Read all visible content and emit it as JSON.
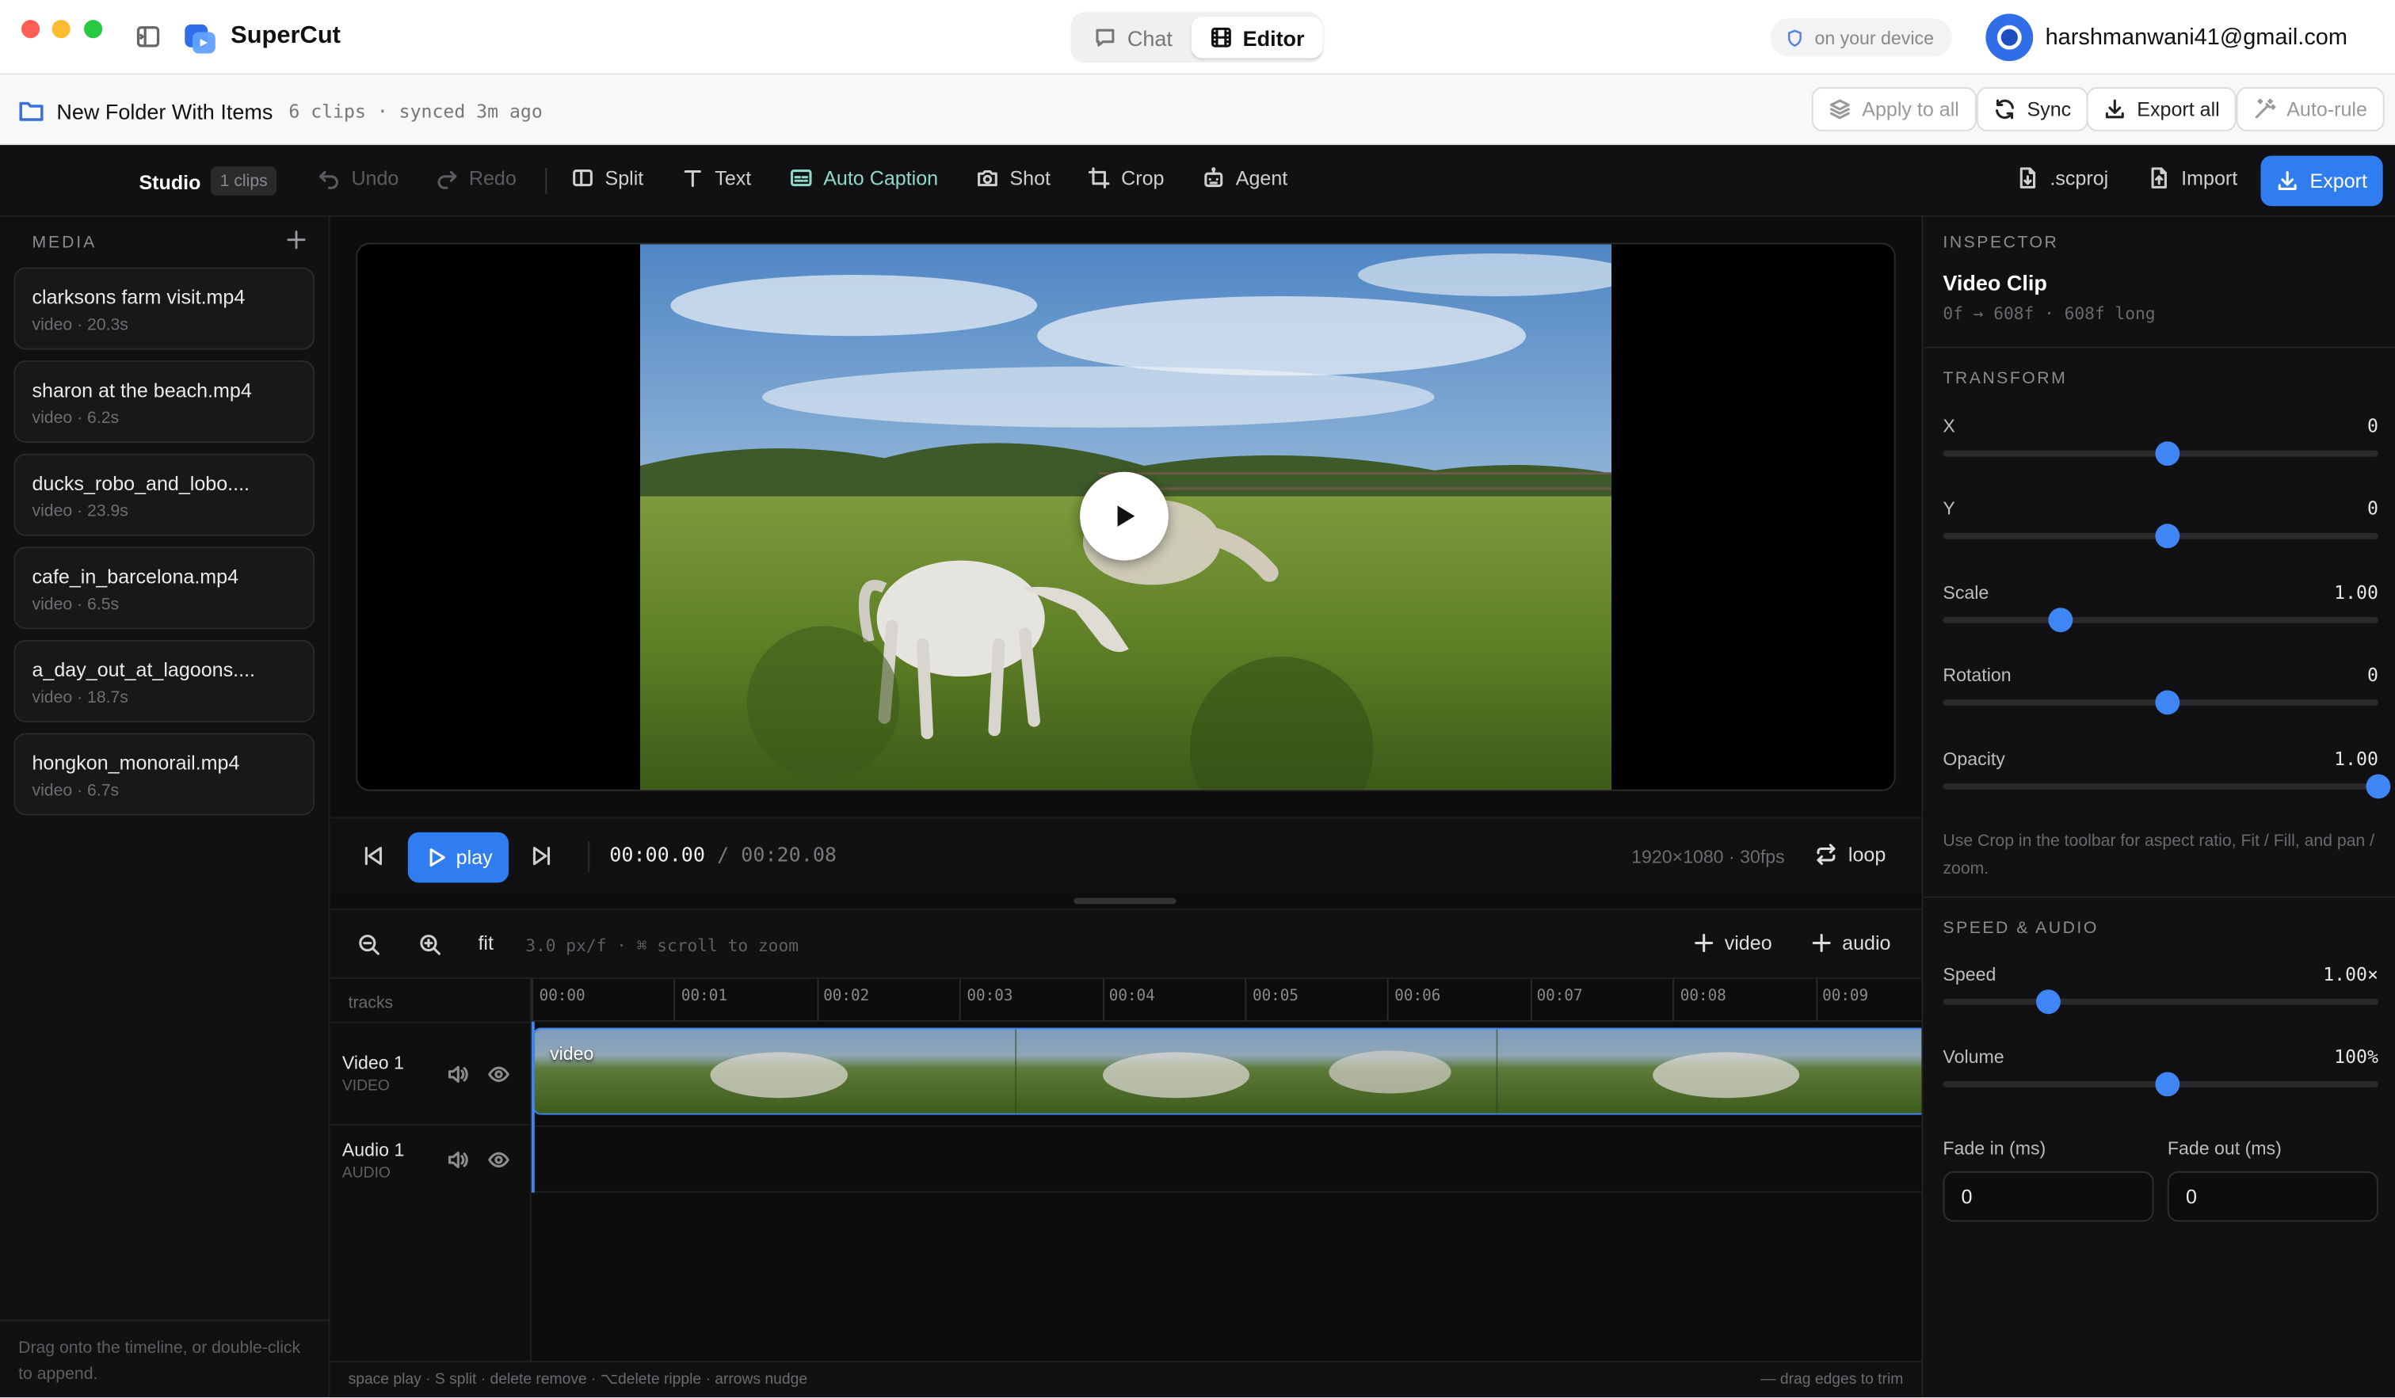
{
  "app": {
    "name": "SuperCut",
    "modes": [
      {
        "label": "Chat",
        "icon": "chat-bubble-icon"
      },
      {
        "label": "Editor",
        "icon": "film-icon",
        "active": true
      }
    ],
    "device_badge": "on your device",
    "user_email": "harshmanwani41@gmail.com"
  },
  "folder": {
    "name": "New Folder With Items",
    "meta": "6 clips · synced 3m ago",
    "actions": {
      "apply_all": "Apply to all",
      "sync": "Sync",
      "export_all": "Export all",
      "auto_rule": "Auto-rule"
    }
  },
  "toolbar": {
    "studio": "Studio",
    "clips_badge": "1 clips",
    "undo": "Undo",
    "redo": "Redo",
    "split": "Split",
    "text": "Text",
    "auto_caption": "Auto Caption",
    "shot": "Shot",
    "crop": "Crop",
    "agent": "Agent",
    "scproj": ".scproj",
    "import": "Import",
    "export": "Export"
  },
  "media": {
    "title": "MEDIA",
    "items": [
      {
        "name": "clarksons farm visit.mp4",
        "meta": "video · 20.3s"
      },
      {
        "name": "sharon at the beach.mp4",
        "meta": "video · 6.2s"
      },
      {
        "name": "ducks_robo_and_lobo....",
        "meta": "video · 23.9s"
      },
      {
        "name": "cafe_in_barcelona.mp4",
        "meta": "video · 6.5s"
      },
      {
        "name": "a_day_out_at_lagoons....",
        "meta": "video · 18.7s"
      },
      {
        "name": "hongkon_monorail.mp4",
        "meta": "video · 6.7s"
      }
    ],
    "hint": "Drag onto the timeline, or double-click to append."
  },
  "player": {
    "play_label": "play",
    "current_time": "00:00.00",
    "total_time": "/ 00:20.08",
    "resolution": "1920×1080 · 30fps",
    "loop_label": "loop"
  },
  "timeline": {
    "fit_label": "fit",
    "zoom_info": "3.0 px/f · ⌘ scroll to zoom",
    "add_video": "video",
    "add_audio": "audio",
    "tracks_label": "tracks",
    "ticks": [
      "00:00",
      "00:01",
      "00:02",
      "00:03",
      "00:04",
      "00:05",
      "00:06",
      "00:07",
      "00:08",
      "00:09"
    ],
    "tracks": [
      {
        "name": "Video 1",
        "type": "VIDEO"
      },
      {
        "name": "Audio 1",
        "type": "AUDIO"
      }
    ],
    "clip_label": "video",
    "shortcuts": "space play · S split · delete remove · ⌥delete ripple · arrows nudge",
    "trim_hint": "— drag edges to trim"
  },
  "inspector": {
    "title": "INSPECTOR",
    "clip_title": "Video Clip",
    "clip_range": "0f → 608f · 608f long",
    "transform_title": "TRANSFORM",
    "transform": [
      {
        "label": "X",
        "value": "0",
        "level": 0.5
      },
      {
        "label": "Y",
        "value": "0",
        "level": 0.5
      },
      {
        "label": "Scale",
        "value": "1.00",
        "level": 0.25
      },
      {
        "label": "Rotation",
        "value": "0",
        "level": 0.5
      },
      {
        "label": "Opacity",
        "value": "1.00",
        "level": 1.0
      }
    ],
    "crop_note": "Use Crop in the toolbar for aspect ratio, Fit / Fill, and pan / zoom.",
    "speed_title": "SPEED & AUDIO",
    "speed_audio": [
      {
        "label": "Speed",
        "value": "1.00×",
        "level": 0.22
      },
      {
        "label": "Volume",
        "value": "100%",
        "level": 0.5
      }
    ],
    "fade_in_label": "Fade in (ms)",
    "fade_in_value": "0",
    "fade_out_label": "Fade out (ms)",
    "fade_out_value": "0"
  },
  "colors": {
    "accent": "#2f7df0",
    "panel": "#111113",
    "background": "#0b0b0c",
    "caption_accent": "#8fd9c8"
  }
}
